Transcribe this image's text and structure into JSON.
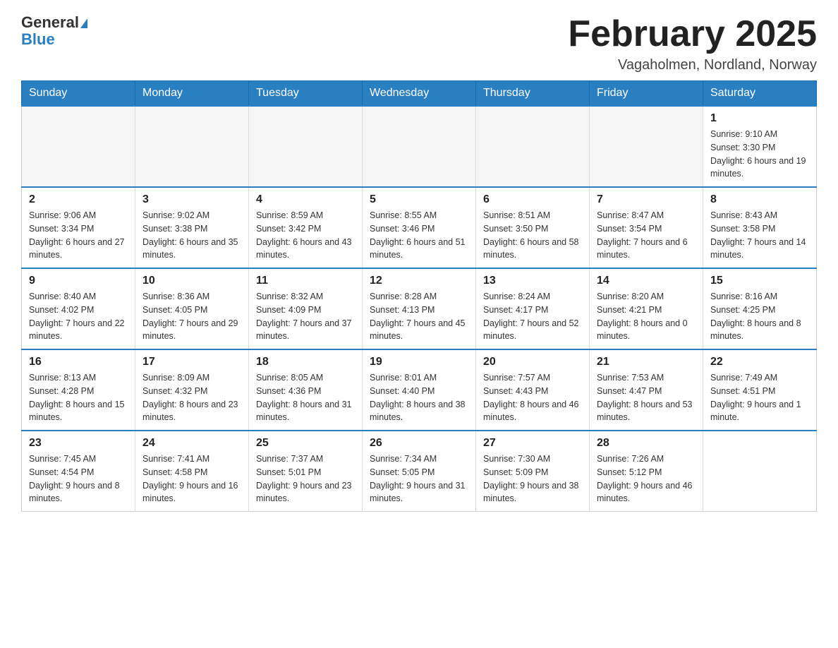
{
  "logo": {
    "general": "General",
    "blue": "Blue"
  },
  "title": "February 2025",
  "subtitle": "Vagaholmen, Nordland, Norway",
  "days_of_week": [
    "Sunday",
    "Monday",
    "Tuesday",
    "Wednesday",
    "Thursday",
    "Friday",
    "Saturday"
  ],
  "weeks": [
    [
      {
        "day": "",
        "info": ""
      },
      {
        "day": "",
        "info": ""
      },
      {
        "day": "",
        "info": ""
      },
      {
        "day": "",
        "info": ""
      },
      {
        "day": "",
        "info": ""
      },
      {
        "day": "",
        "info": ""
      },
      {
        "day": "1",
        "info": "Sunrise: 9:10 AM\nSunset: 3:30 PM\nDaylight: 6 hours and 19 minutes."
      }
    ],
    [
      {
        "day": "2",
        "info": "Sunrise: 9:06 AM\nSunset: 3:34 PM\nDaylight: 6 hours and 27 minutes."
      },
      {
        "day": "3",
        "info": "Sunrise: 9:02 AM\nSunset: 3:38 PM\nDaylight: 6 hours and 35 minutes."
      },
      {
        "day": "4",
        "info": "Sunrise: 8:59 AM\nSunset: 3:42 PM\nDaylight: 6 hours and 43 minutes."
      },
      {
        "day": "5",
        "info": "Sunrise: 8:55 AM\nSunset: 3:46 PM\nDaylight: 6 hours and 51 minutes."
      },
      {
        "day": "6",
        "info": "Sunrise: 8:51 AM\nSunset: 3:50 PM\nDaylight: 6 hours and 58 minutes."
      },
      {
        "day": "7",
        "info": "Sunrise: 8:47 AM\nSunset: 3:54 PM\nDaylight: 7 hours and 6 minutes."
      },
      {
        "day": "8",
        "info": "Sunrise: 8:43 AM\nSunset: 3:58 PM\nDaylight: 7 hours and 14 minutes."
      }
    ],
    [
      {
        "day": "9",
        "info": "Sunrise: 8:40 AM\nSunset: 4:02 PM\nDaylight: 7 hours and 22 minutes."
      },
      {
        "day": "10",
        "info": "Sunrise: 8:36 AM\nSunset: 4:05 PM\nDaylight: 7 hours and 29 minutes."
      },
      {
        "day": "11",
        "info": "Sunrise: 8:32 AM\nSunset: 4:09 PM\nDaylight: 7 hours and 37 minutes."
      },
      {
        "day": "12",
        "info": "Sunrise: 8:28 AM\nSunset: 4:13 PM\nDaylight: 7 hours and 45 minutes."
      },
      {
        "day": "13",
        "info": "Sunrise: 8:24 AM\nSunset: 4:17 PM\nDaylight: 7 hours and 52 minutes."
      },
      {
        "day": "14",
        "info": "Sunrise: 8:20 AM\nSunset: 4:21 PM\nDaylight: 8 hours and 0 minutes."
      },
      {
        "day": "15",
        "info": "Sunrise: 8:16 AM\nSunset: 4:25 PM\nDaylight: 8 hours and 8 minutes."
      }
    ],
    [
      {
        "day": "16",
        "info": "Sunrise: 8:13 AM\nSunset: 4:28 PM\nDaylight: 8 hours and 15 minutes."
      },
      {
        "day": "17",
        "info": "Sunrise: 8:09 AM\nSunset: 4:32 PM\nDaylight: 8 hours and 23 minutes."
      },
      {
        "day": "18",
        "info": "Sunrise: 8:05 AM\nSunset: 4:36 PM\nDaylight: 8 hours and 31 minutes."
      },
      {
        "day": "19",
        "info": "Sunrise: 8:01 AM\nSunset: 4:40 PM\nDaylight: 8 hours and 38 minutes."
      },
      {
        "day": "20",
        "info": "Sunrise: 7:57 AM\nSunset: 4:43 PM\nDaylight: 8 hours and 46 minutes."
      },
      {
        "day": "21",
        "info": "Sunrise: 7:53 AM\nSunset: 4:47 PM\nDaylight: 8 hours and 53 minutes."
      },
      {
        "day": "22",
        "info": "Sunrise: 7:49 AM\nSunset: 4:51 PM\nDaylight: 9 hours and 1 minute."
      }
    ],
    [
      {
        "day": "23",
        "info": "Sunrise: 7:45 AM\nSunset: 4:54 PM\nDaylight: 9 hours and 8 minutes."
      },
      {
        "day": "24",
        "info": "Sunrise: 7:41 AM\nSunset: 4:58 PM\nDaylight: 9 hours and 16 minutes."
      },
      {
        "day": "25",
        "info": "Sunrise: 7:37 AM\nSunset: 5:01 PM\nDaylight: 9 hours and 23 minutes."
      },
      {
        "day": "26",
        "info": "Sunrise: 7:34 AM\nSunset: 5:05 PM\nDaylight: 9 hours and 31 minutes."
      },
      {
        "day": "27",
        "info": "Sunrise: 7:30 AM\nSunset: 5:09 PM\nDaylight: 9 hours and 38 minutes."
      },
      {
        "day": "28",
        "info": "Sunrise: 7:26 AM\nSunset: 5:12 PM\nDaylight: 9 hours and 46 minutes."
      },
      {
        "day": "",
        "info": ""
      }
    ]
  ]
}
